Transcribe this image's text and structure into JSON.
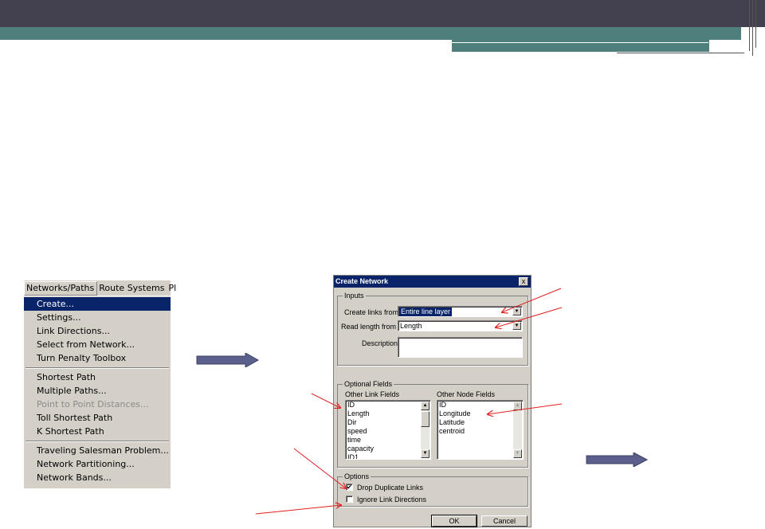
{
  "menu": {
    "bar": [
      "Networks/Paths",
      "Route Systems",
      "Pl"
    ],
    "items": [
      {
        "label": "Create...",
        "state": "selected"
      },
      {
        "label": "Settings...",
        "state": "normal"
      },
      {
        "label": "Link Directions...",
        "state": "normal"
      },
      {
        "label": "Select from Network...",
        "state": "normal"
      },
      {
        "label": "Turn Penalty Toolbox",
        "state": "normal"
      },
      {
        "label": "Shortest Path",
        "state": "normal"
      },
      {
        "label": "Multiple Paths...",
        "state": "normal"
      },
      {
        "label": "Point to Point Distances...",
        "state": "disabled"
      },
      {
        "label": "Toll Shortest Path",
        "state": "normal"
      },
      {
        "label": "K Shortest Path",
        "state": "normal"
      },
      {
        "label": "Traveling Salesman Problem...",
        "state": "normal"
      },
      {
        "label": "Network Partitioning...",
        "state": "normal"
      },
      {
        "label": "Network Bands...",
        "state": "normal"
      }
    ]
  },
  "dialog": {
    "title": "Create Network",
    "close": "x",
    "inputs_group": "Inputs",
    "create_links_label": "Create links from",
    "create_links_value": "Entire line layer",
    "read_length_label": "Read length from",
    "read_length_value": "Length",
    "description_label": "Description",
    "description_value": "",
    "optional_group": "Optional Fields",
    "link_fields_label": "Other Link Fields",
    "link_fields": [
      "ID",
      "Length",
      "Dir",
      "speed",
      "time",
      "capacity",
      "ID1"
    ],
    "node_fields_label": "Other Node Fields",
    "node_fields": [
      "ID",
      "Longitude",
      "Latitude",
      "centroid"
    ],
    "options_group": "Options",
    "drop_duplicates_label": "Drop Duplicate Links",
    "drop_duplicates_checked": true,
    "ignore_directions_label": "Ignore Link Directions",
    "ignore_directions_checked": false,
    "ok_label": "OK",
    "cancel_label": "Cancel"
  },
  "colors": {
    "header_dark": "#434150",
    "header_teal": "#4e7f7c",
    "arrow_fill": "#5a5f8c",
    "annotation_red": "#e02020",
    "selection": "#0a246a"
  }
}
